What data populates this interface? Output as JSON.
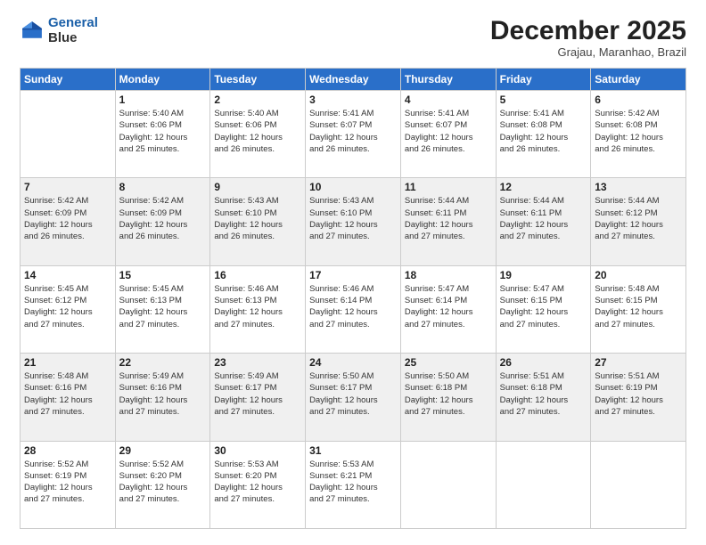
{
  "logo": {
    "line1": "General",
    "line2": "Blue"
  },
  "header": {
    "month": "December 2025",
    "location": "Grajau, Maranhao, Brazil"
  },
  "weekdays": [
    "Sunday",
    "Monday",
    "Tuesday",
    "Wednesday",
    "Thursday",
    "Friday",
    "Saturday"
  ],
  "weeks": [
    [
      {
        "day": "",
        "info": ""
      },
      {
        "day": "1",
        "info": "Sunrise: 5:40 AM\nSunset: 6:06 PM\nDaylight: 12 hours\nand 25 minutes."
      },
      {
        "day": "2",
        "info": "Sunrise: 5:40 AM\nSunset: 6:06 PM\nDaylight: 12 hours\nand 26 minutes."
      },
      {
        "day": "3",
        "info": "Sunrise: 5:41 AM\nSunset: 6:07 PM\nDaylight: 12 hours\nand 26 minutes."
      },
      {
        "day": "4",
        "info": "Sunrise: 5:41 AM\nSunset: 6:07 PM\nDaylight: 12 hours\nand 26 minutes."
      },
      {
        "day": "5",
        "info": "Sunrise: 5:41 AM\nSunset: 6:08 PM\nDaylight: 12 hours\nand 26 minutes."
      },
      {
        "day": "6",
        "info": "Sunrise: 5:42 AM\nSunset: 6:08 PM\nDaylight: 12 hours\nand 26 minutes."
      }
    ],
    [
      {
        "day": "7",
        "info": "Sunrise: 5:42 AM\nSunset: 6:09 PM\nDaylight: 12 hours\nand 26 minutes."
      },
      {
        "day": "8",
        "info": "Sunrise: 5:42 AM\nSunset: 6:09 PM\nDaylight: 12 hours\nand 26 minutes."
      },
      {
        "day": "9",
        "info": "Sunrise: 5:43 AM\nSunset: 6:10 PM\nDaylight: 12 hours\nand 26 minutes."
      },
      {
        "day": "10",
        "info": "Sunrise: 5:43 AM\nSunset: 6:10 PM\nDaylight: 12 hours\nand 27 minutes."
      },
      {
        "day": "11",
        "info": "Sunrise: 5:44 AM\nSunset: 6:11 PM\nDaylight: 12 hours\nand 27 minutes."
      },
      {
        "day": "12",
        "info": "Sunrise: 5:44 AM\nSunset: 6:11 PM\nDaylight: 12 hours\nand 27 minutes."
      },
      {
        "day": "13",
        "info": "Sunrise: 5:44 AM\nSunset: 6:12 PM\nDaylight: 12 hours\nand 27 minutes."
      }
    ],
    [
      {
        "day": "14",
        "info": "Sunrise: 5:45 AM\nSunset: 6:12 PM\nDaylight: 12 hours\nand 27 minutes."
      },
      {
        "day": "15",
        "info": "Sunrise: 5:45 AM\nSunset: 6:13 PM\nDaylight: 12 hours\nand 27 minutes."
      },
      {
        "day": "16",
        "info": "Sunrise: 5:46 AM\nSunset: 6:13 PM\nDaylight: 12 hours\nand 27 minutes."
      },
      {
        "day": "17",
        "info": "Sunrise: 5:46 AM\nSunset: 6:14 PM\nDaylight: 12 hours\nand 27 minutes."
      },
      {
        "day": "18",
        "info": "Sunrise: 5:47 AM\nSunset: 6:14 PM\nDaylight: 12 hours\nand 27 minutes."
      },
      {
        "day": "19",
        "info": "Sunrise: 5:47 AM\nSunset: 6:15 PM\nDaylight: 12 hours\nand 27 minutes."
      },
      {
        "day": "20",
        "info": "Sunrise: 5:48 AM\nSunset: 6:15 PM\nDaylight: 12 hours\nand 27 minutes."
      }
    ],
    [
      {
        "day": "21",
        "info": "Sunrise: 5:48 AM\nSunset: 6:16 PM\nDaylight: 12 hours\nand 27 minutes."
      },
      {
        "day": "22",
        "info": "Sunrise: 5:49 AM\nSunset: 6:16 PM\nDaylight: 12 hours\nand 27 minutes."
      },
      {
        "day": "23",
        "info": "Sunrise: 5:49 AM\nSunset: 6:17 PM\nDaylight: 12 hours\nand 27 minutes."
      },
      {
        "day": "24",
        "info": "Sunrise: 5:50 AM\nSunset: 6:17 PM\nDaylight: 12 hours\nand 27 minutes."
      },
      {
        "day": "25",
        "info": "Sunrise: 5:50 AM\nSunset: 6:18 PM\nDaylight: 12 hours\nand 27 minutes."
      },
      {
        "day": "26",
        "info": "Sunrise: 5:51 AM\nSunset: 6:18 PM\nDaylight: 12 hours\nand 27 minutes."
      },
      {
        "day": "27",
        "info": "Sunrise: 5:51 AM\nSunset: 6:19 PM\nDaylight: 12 hours\nand 27 minutes."
      }
    ],
    [
      {
        "day": "28",
        "info": "Sunrise: 5:52 AM\nSunset: 6:19 PM\nDaylight: 12 hours\nand 27 minutes."
      },
      {
        "day": "29",
        "info": "Sunrise: 5:52 AM\nSunset: 6:20 PM\nDaylight: 12 hours\nand 27 minutes."
      },
      {
        "day": "30",
        "info": "Sunrise: 5:53 AM\nSunset: 6:20 PM\nDaylight: 12 hours\nand 27 minutes."
      },
      {
        "day": "31",
        "info": "Sunrise: 5:53 AM\nSunset: 6:21 PM\nDaylight: 12 hours\nand 27 minutes."
      },
      {
        "day": "",
        "info": ""
      },
      {
        "day": "",
        "info": ""
      },
      {
        "day": "",
        "info": ""
      }
    ]
  ]
}
